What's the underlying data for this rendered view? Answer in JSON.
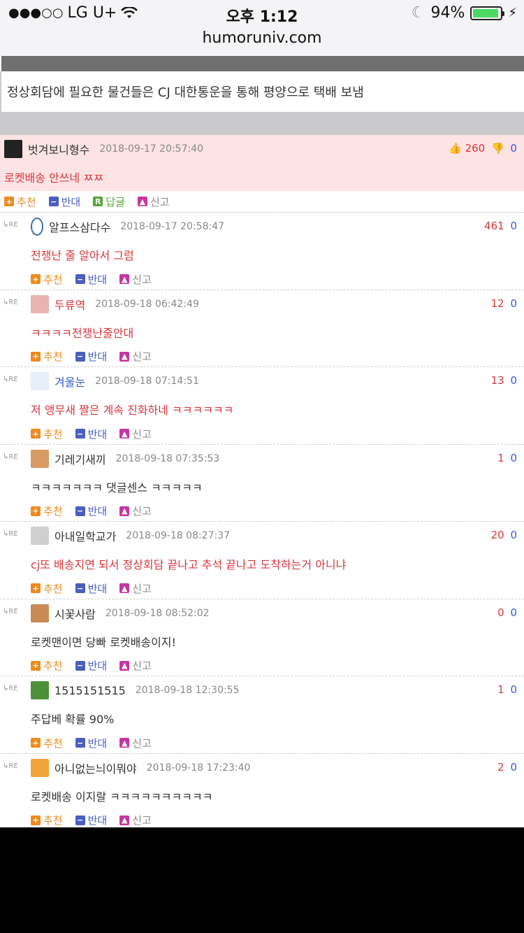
{
  "status": {
    "carrier": "LG U+",
    "time": "오후 1:12",
    "battery": "94%",
    "url": "humoruniv.com",
    "signal_dots": "●●●○○"
  },
  "post": {
    "caption": "정상회담에 필요한 물건들은 CJ 대한통운을 통해 평양으로 택배 보냄"
  },
  "labels": {
    "recommend": "추천",
    "oppose": "반대",
    "reply": "답글",
    "report": "신고",
    "re": "RE"
  },
  "best": {
    "nick": "벗겨보니형수",
    "date": "2018-09-17 20:57:40",
    "up": "260",
    "down": "0",
    "text": "로켓배송 안쓰네 ㅉㅉ"
  },
  "replies": [
    {
      "nick": "알프스삼다수",
      "date": "2018-09-17 20:58:47",
      "up": "461",
      "down": "0",
      "text": "전쟁난 줄 알아서 그럼",
      "red": true,
      "avatar": "#ffffff",
      "avatar_border": "#3a6fb0"
    },
    {
      "nick": "두류역",
      "date": "2018-09-18 06:42:49",
      "up": "12",
      "down": "0",
      "text": "ㅋㅋㅋㅋ전쟁난줄안대",
      "red": true,
      "avatar": "#e9b3b3",
      "nick_red": true
    },
    {
      "nick": "겨울눈",
      "date": "2018-09-18 07:14:51",
      "up": "13",
      "down": "0",
      "text": "저 앵무새 짤은 계속 진화하네 ㅋㅋㅋㅋㅋㅋ",
      "red": true,
      "avatar": "#e6eef8",
      "nick_blue": true
    },
    {
      "nick": "기레기새끼",
      "date": "2018-09-18 07:35:53",
      "up": "1",
      "down": "0",
      "text": "ㅋㅋㅋㅋㅋㅋㅋ 댓글센스 ㅋㅋㅋㅋㅋ",
      "red": false,
      "avatar": "#d99a63"
    },
    {
      "nick": "아내일학교가",
      "date": "2018-09-18 08:27:37",
      "up": "20",
      "down": "0",
      "text": "cj또 배송지연 되서 정상회담 끝나고 추석 끝나고 도착하는거 아니냐",
      "red": true,
      "avatar": "#cfcfcf"
    },
    {
      "nick": "시꽃사람",
      "date": "2018-09-18 08:52:02",
      "up": "0",
      "down": "0",
      "text": "로켓맨이면 당빠 로켓배송이지!",
      "red": false,
      "avatar": "#c98a55"
    },
    {
      "nick": "1515151515",
      "date": "2018-09-18 12:30:55",
      "up": "1",
      "down": "0",
      "text": "주답베 확률 90%",
      "red": false,
      "avatar": "#4e8f3a"
    },
    {
      "nick": "아니없는늬이뭐야",
      "date": "2018-09-18 17:23:40",
      "up": "2",
      "down": "0",
      "text": "로켓배송 이지랄 ㅋㅋㅋㅋㅋㅋㅋㅋㅋㅋ",
      "red": false,
      "avatar": "#f0a33a"
    }
  ]
}
